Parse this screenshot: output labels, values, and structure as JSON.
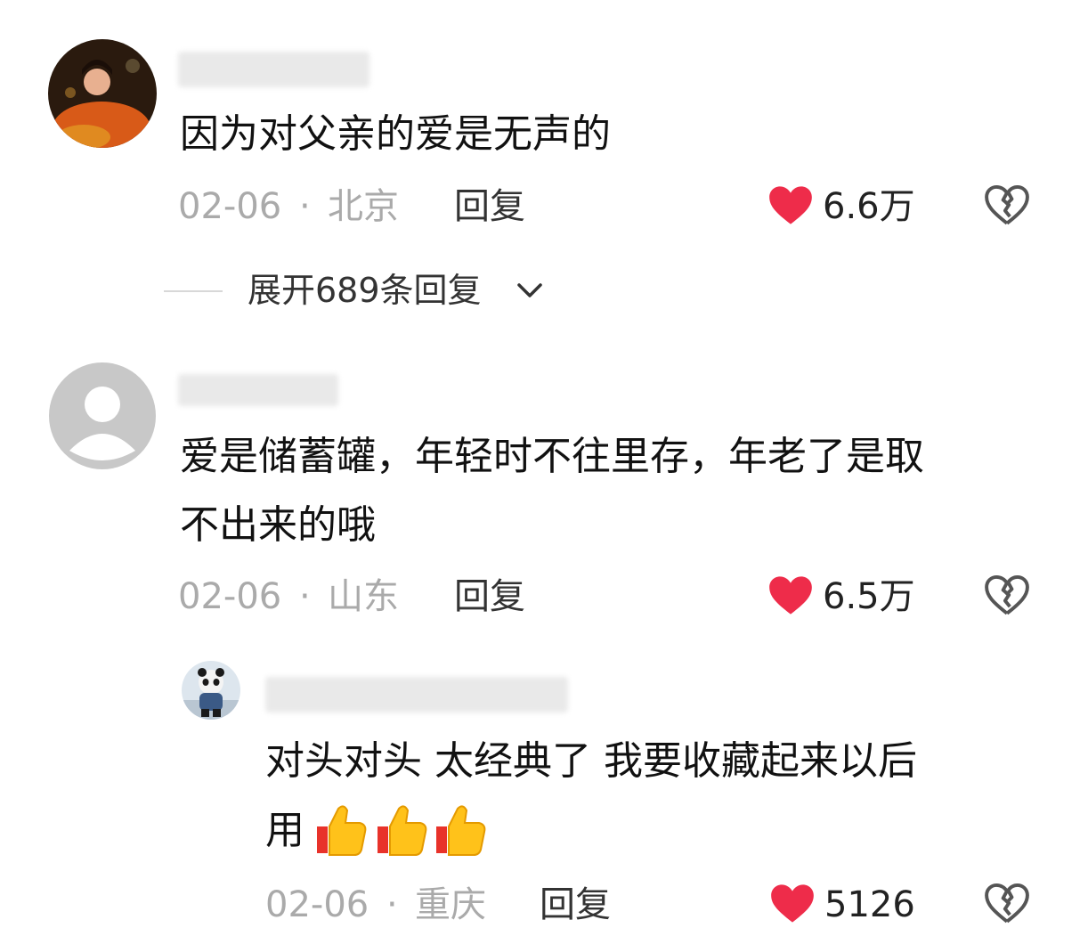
{
  "comments": [
    {
      "text": "因为对父亲的爱是无声的",
      "date": "02-06",
      "separator": "·",
      "location": "北京",
      "reply_label": "回复",
      "likes": "6.6万",
      "expand_label": "展开689条回复"
    },
    {
      "text_line1": "爱是储蓄罐，年轻时不往里存，年老了是取",
      "text_line2": "不出来的哦",
      "date": "02-06",
      "separator": "·",
      "location": "山东",
      "reply_label": "回复",
      "likes": "6.5万"
    },
    {
      "text_line1": "对头对头 太经典了 我要收藏起来以后",
      "text_line2": "用",
      "emoji_icons": [
        "thumbs-up-icon",
        "thumbs-up-icon",
        "thumbs-up-icon"
      ],
      "date": "02-06",
      "separator": "·",
      "location": "重庆",
      "reply_label": "回复",
      "likes": "5126"
    }
  ],
  "colors": {
    "heart": "#ee2c4a",
    "meta": "#aaaaaa"
  }
}
